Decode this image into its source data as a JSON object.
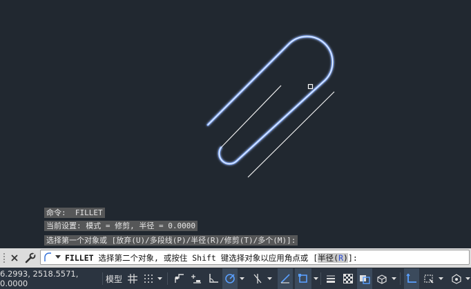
{
  "history": {
    "line1": "命令:  FILLET",
    "line2": "当前设置: 模式 = 修剪, 半径 = 0.0000",
    "line3": "选择第一个对象或 [放弃(U)/多段线(P)/半径(R)/修剪(T)/多个(M)]:"
  },
  "command": {
    "name": "FILLET",
    "prompt": " 选择第二个对象, 或按住 Shift 键选择对象以应用角点或 [",
    "option_label": "半径(",
    "option_key": "R",
    "option_close": ")",
    "suffix": "]:"
  },
  "status": {
    "coordinates": "6.2993, 2518.5571, 0.0000",
    "model_label": "模型"
  },
  "colors": {
    "background": "#212830",
    "highlight": "#7aa7ff",
    "line": "#f0f0f0"
  }
}
